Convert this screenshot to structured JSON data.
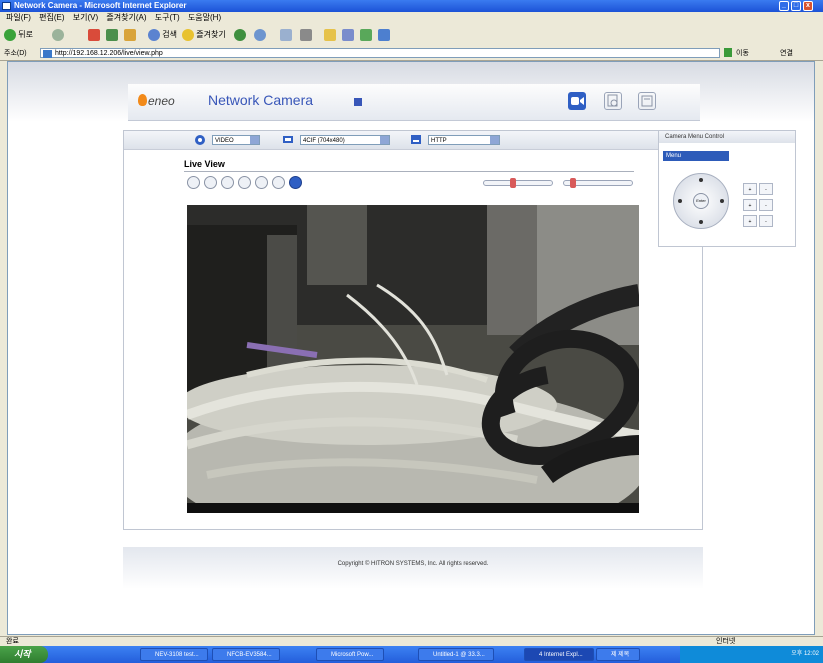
{
  "window": {
    "title": "Network Camera - Microsoft Internet Explorer"
  },
  "menubar": {
    "items": [
      "파일(F)",
      "편집(E)",
      "보기(V)",
      "즐겨찾기(A)",
      "도구(T)",
      "도움말(H)"
    ]
  },
  "toolbar": {
    "back_label": "뒤로",
    "search_label": "검색",
    "favorites_label": "즐겨찾기"
  },
  "address": {
    "label": "주소(D)",
    "url": "http://192.168.12.206/live/view.php",
    "go_label": "이동",
    "links_label": "연결"
  },
  "header": {
    "brand": "eneo",
    "app_name": "Network Camera"
  },
  "selectors": {
    "video": "VIDEO",
    "resolution": "4CIF (704x480)",
    "protocol": "HTTP"
  },
  "liveview": {
    "title": "Live View"
  },
  "menu_control": {
    "title": "Camera Menu Control",
    "tab": "Menu",
    "center_label": "Enter"
  },
  "footer": {
    "copyright": "Copyright © HITRON SYSTEMS, Inc. All rights reserved."
  },
  "statusbar": {
    "left": "완료",
    "zone": "인터넷"
  },
  "taskbar": {
    "start": "시작",
    "tasks": [
      "NEV-3108 test...",
      "NFCB-EV3584...",
      "Microsoft Pow...",
      "Untitled-1 @ 33.3...",
      "4 Internet Expl...",
      "제 제목"
    ],
    "clock": "오후 12:02"
  }
}
